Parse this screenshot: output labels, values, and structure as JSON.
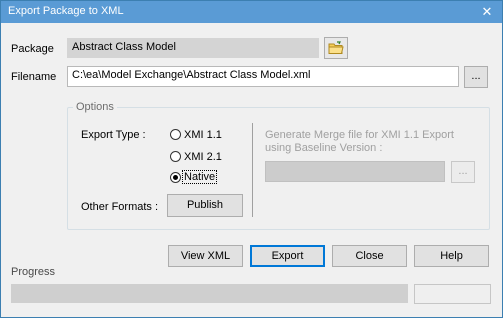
{
  "window": {
    "title": "Export Package to XML",
    "close_glyph": "✕"
  },
  "package": {
    "label": "Package",
    "value": "Abstract Class Model",
    "browse_icon": "folder-icon"
  },
  "filename": {
    "label": "Filename",
    "value": "C:\\ea\\Model Exchange\\Abstract Class Model.xml",
    "browse_label": "..."
  },
  "options": {
    "title": "Options",
    "export_type_label": "Export Type :",
    "types": [
      {
        "label": "XMI 1.1",
        "selected": false
      },
      {
        "label": "XMI 2.1",
        "selected": false
      },
      {
        "label": "Native",
        "selected": true
      }
    ],
    "other_formats_label": "Other Formats :",
    "publish_label": "Publish",
    "merge_label_line1": "Generate Merge file for XMI 1.1 Export",
    "merge_label_line2": "using Baseline Version :",
    "merge_browse_label": "..."
  },
  "buttons": {
    "view_xml": "View XML",
    "export": "Export",
    "close": "Close",
    "help": "Help"
  },
  "progress": {
    "label": "Progress",
    "value": 0
  }
}
